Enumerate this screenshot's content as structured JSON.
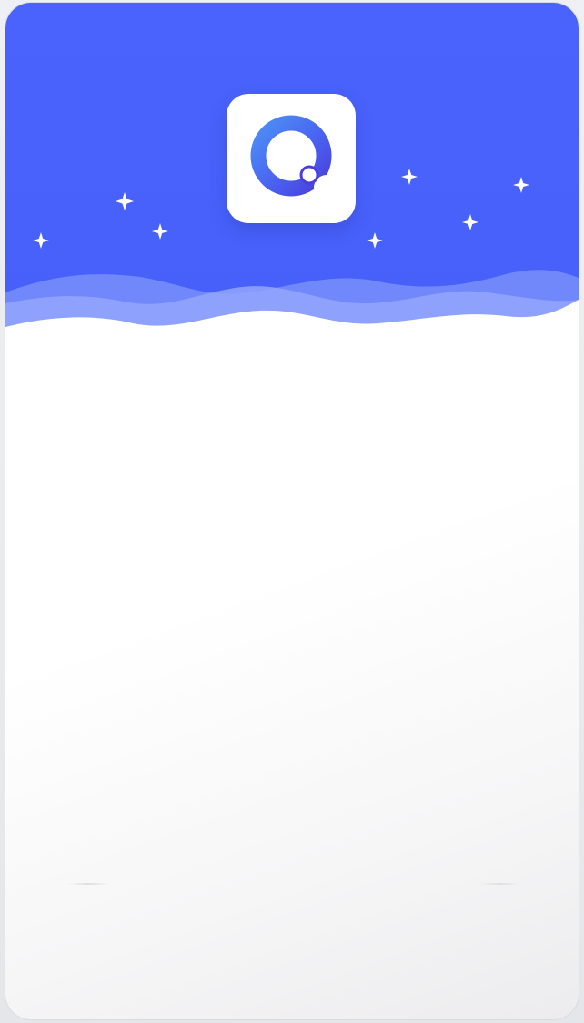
{
  "app": {
    "logo_icon": "q-logo-icon",
    "brand_color": "#4862fb",
    "accent_color": "#3b4ee6"
  },
  "header": {
    "background_color": "#4862fb",
    "decorations": [
      "sparkle-icon",
      "wave-shape"
    ]
  },
  "main": {
    "background_color": "#ffffff"
  }
}
